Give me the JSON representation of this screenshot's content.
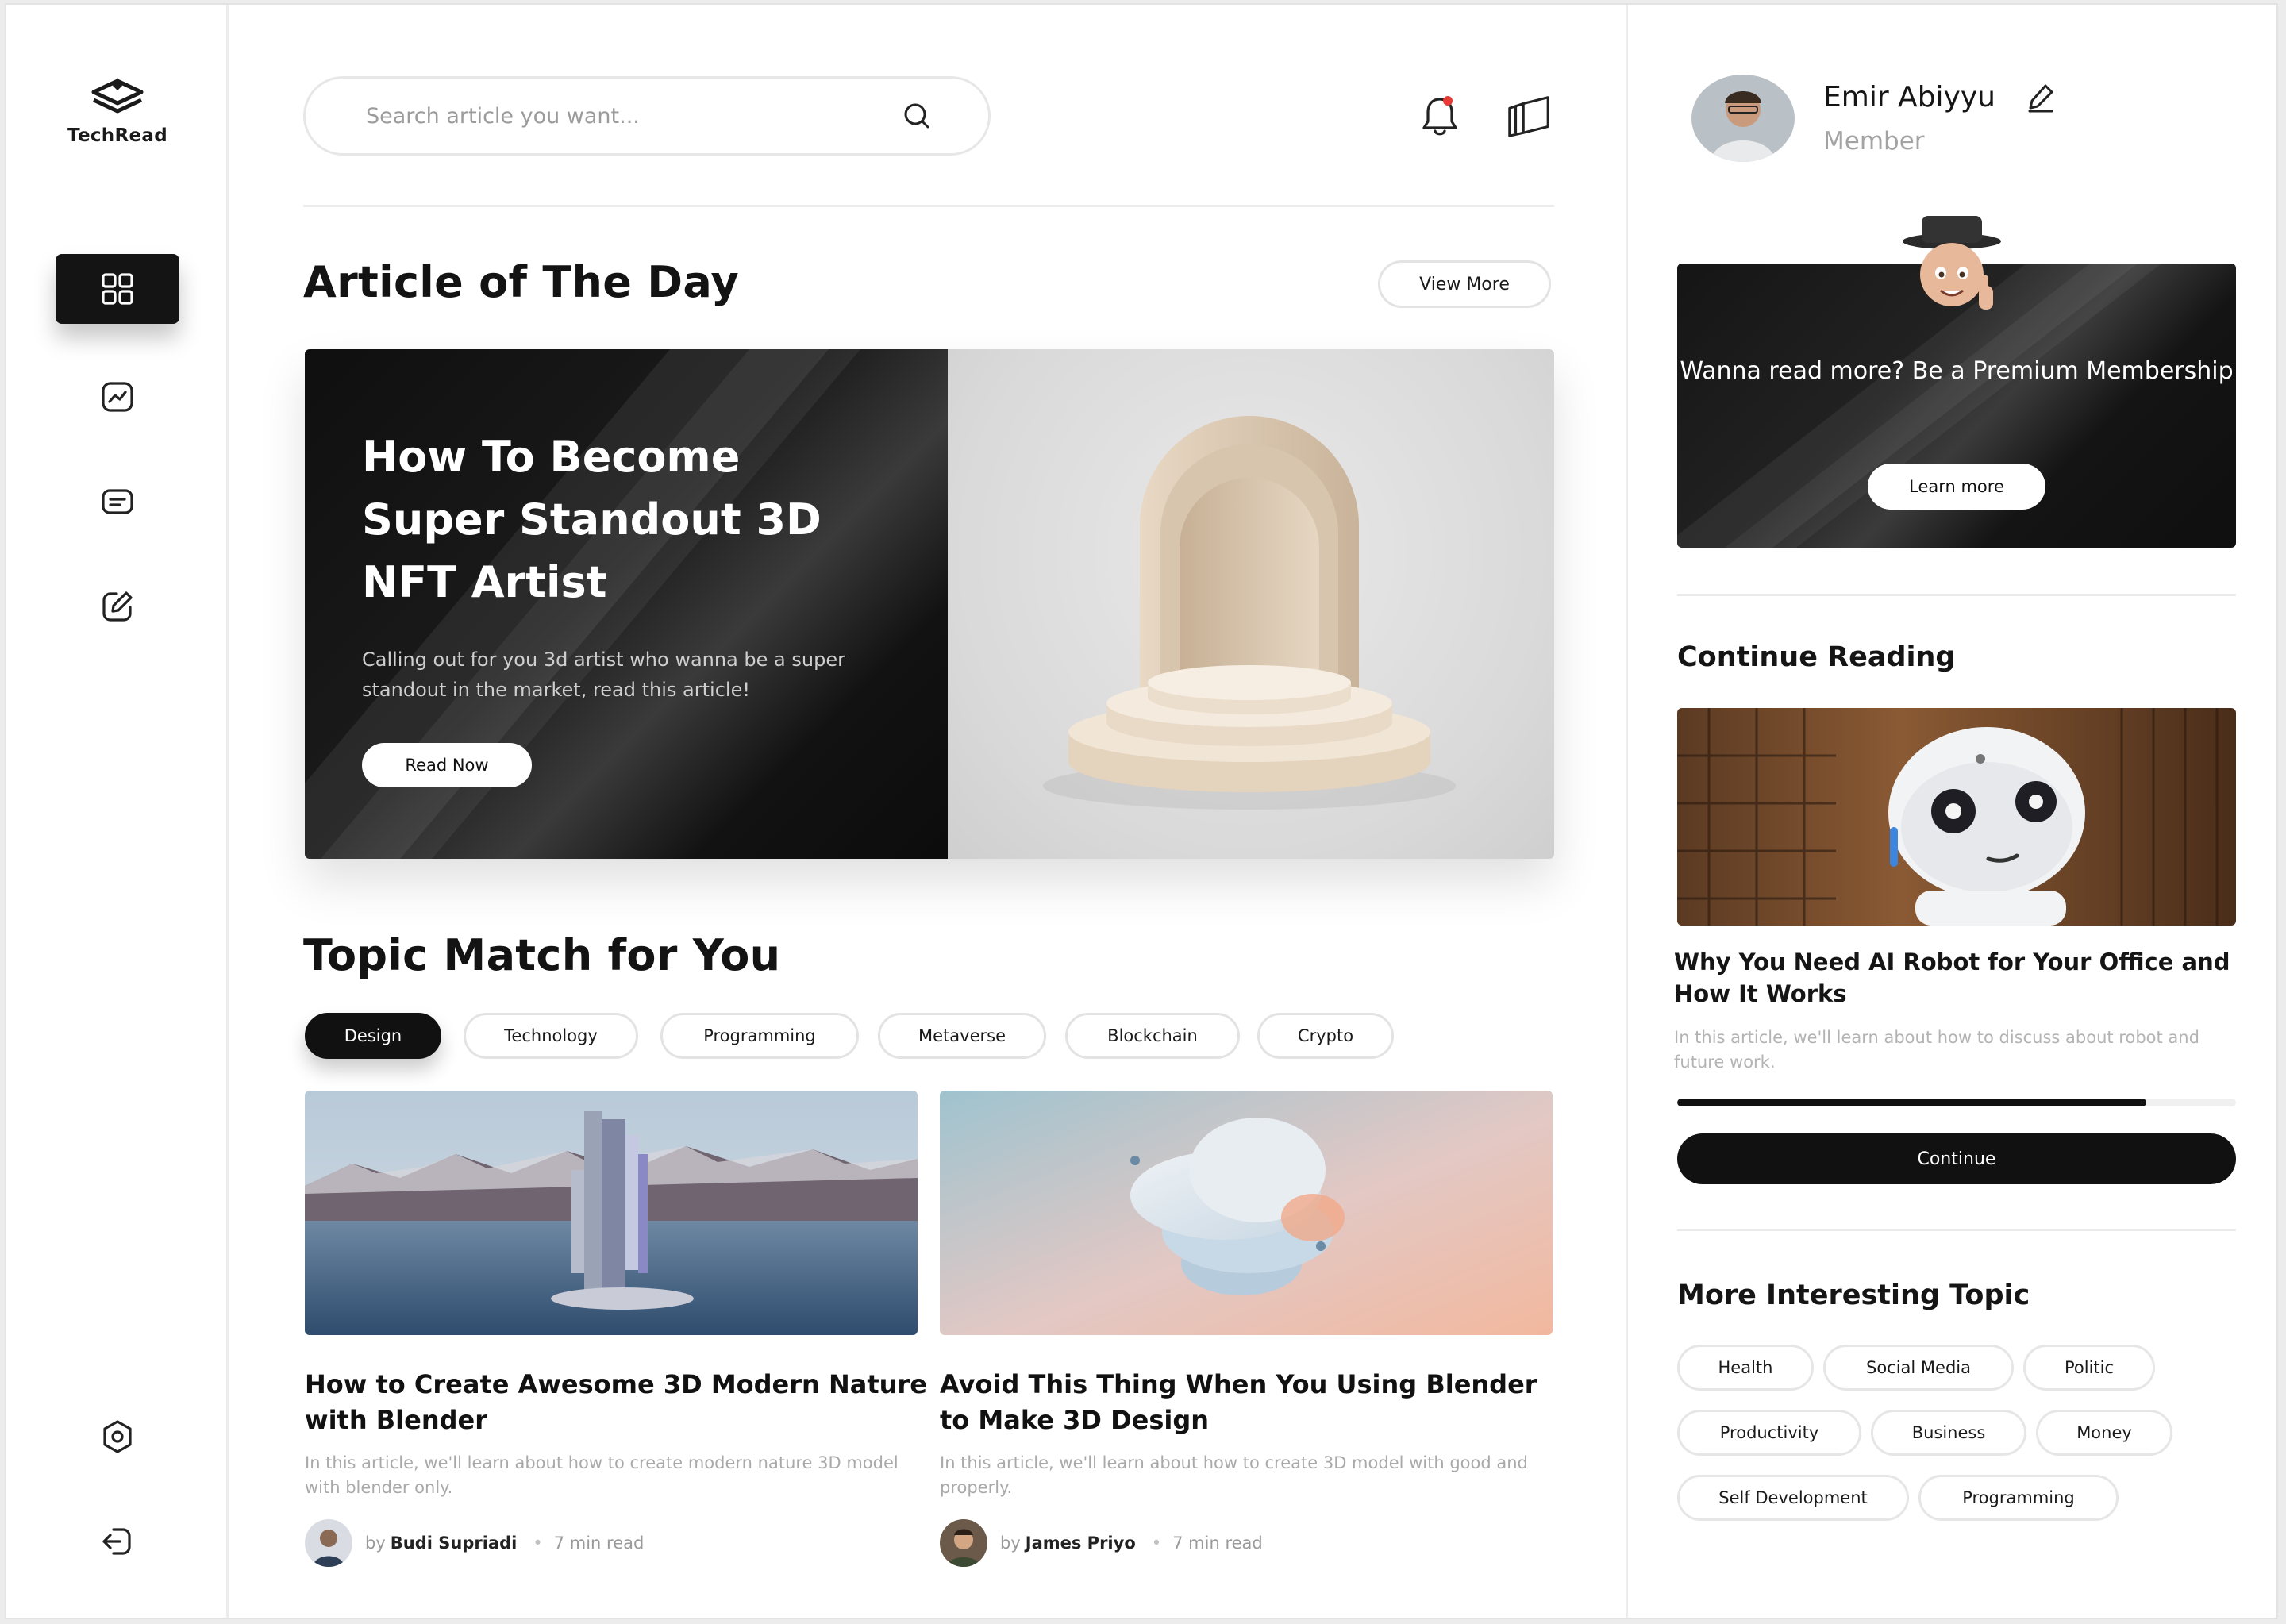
{
  "brand": {
    "name": "TechRead"
  },
  "sidebar": {
    "items": [
      {
        "icon": "dashboard-grid-icon",
        "active": true
      },
      {
        "icon": "trending-chart-icon",
        "active": false
      },
      {
        "icon": "message-list-icon",
        "active": false
      },
      {
        "icon": "edit-write-icon",
        "active": false
      }
    ],
    "bottom": [
      {
        "icon": "settings-gear-icon"
      },
      {
        "icon": "logout-icon"
      }
    ]
  },
  "header": {
    "search_placeholder": "Search article you want...",
    "notification_badge_color": "#e53935"
  },
  "article_of_day": {
    "heading": "Article of The Day",
    "view_more": "View More",
    "title": "How To Become Super Standout 3D NFT Artist",
    "description": "Calling out for you 3d artist who wanna be a super standout in the market, read this article!",
    "cta": "Read Now"
  },
  "topics": {
    "heading": "Topic Match for You",
    "chips": [
      "Design",
      "Technology",
      "Programming",
      "Metaverse",
      "Blockchain",
      "Crypto"
    ],
    "active": "Design"
  },
  "cards": [
    {
      "title": "How to Create Awesome 3D Modern Nature with Blender",
      "description": "In this article, we'll learn about how to create modern nature 3D model with blender only.",
      "by": "by",
      "author": "Budi Supriadi",
      "read_time": "7 min read"
    },
    {
      "title": "Avoid This Thing When You Using Blender to Make 3D Design",
      "description": "In this article, we'll learn about how to create 3D model with good and properly.",
      "by": "by",
      "author": "James Priyo",
      "read_time": "7 min read"
    }
  ],
  "profile": {
    "name": "Emir Abiyyu",
    "role": "Member"
  },
  "promo": {
    "text": "Wanna read more? Be a Premium Membership",
    "cta": "Learn more"
  },
  "continue_reading": {
    "heading": "Continue Reading",
    "title": "Why You Need AI Robot for Your Office and How It Works",
    "description": "In this article, we'll learn about how to discuss about robot and future work.",
    "progress": 0.84,
    "cta": "Continue"
  },
  "more_topics": {
    "heading": "More Interesting Topic",
    "tags": [
      "Health",
      "Social Media",
      "Politic",
      "Productivity",
      "Business",
      "Money",
      "Self Development",
      "Programming"
    ]
  }
}
